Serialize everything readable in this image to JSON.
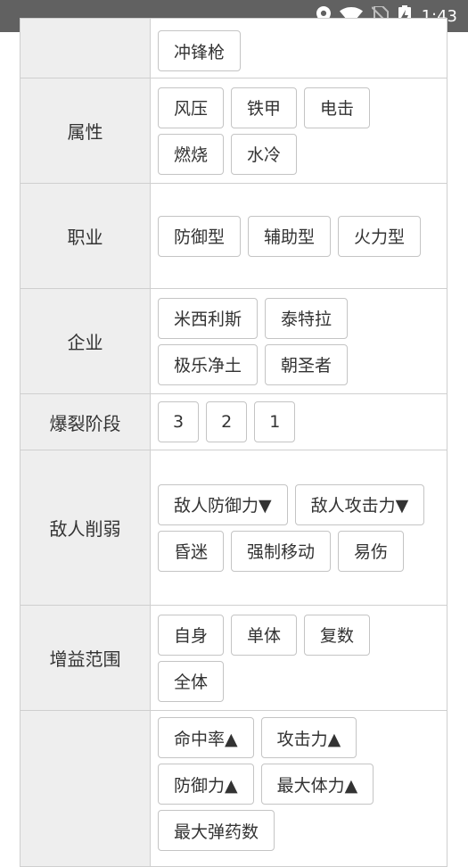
{
  "status_bar": {
    "time": "1:43"
  },
  "filters": {
    "weapon": {
      "label": "",
      "options": [
        "冲锋枪"
      ]
    },
    "attribute": {
      "label": "属性",
      "options": [
        "风压",
        "铁甲",
        "电击",
        "燃烧",
        "水冷"
      ]
    },
    "class": {
      "label": "职业",
      "options": [
        "防御型",
        "辅助型",
        "火力型"
      ]
    },
    "company": {
      "label": "企业",
      "options": [
        "米西利斯",
        "泰特拉",
        "极乐净土",
        "朝圣者"
      ]
    },
    "burst": {
      "label": "爆裂阶段",
      "options": [
        "3",
        "2",
        "1"
      ]
    },
    "debuff": {
      "label": "敌人削弱",
      "options": [
        "敌人防御力▼",
        "敌人攻击力▼",
        "昏迷",
        "强制移动",
        "易伤"
      ]
    },
    "buff_range": {
      "label": "增益范围",
      "options": [
        "自身",
        "单体",
        "复数",
        "全体"
      ]
    },
    "buff": {
      "label": "",
      "options": [
        "命中率▲",
        "攻击力▲",
        "防御力▲",
        "最大体力▲",
        "最大弹药数"
      ]
    }
  }
}
